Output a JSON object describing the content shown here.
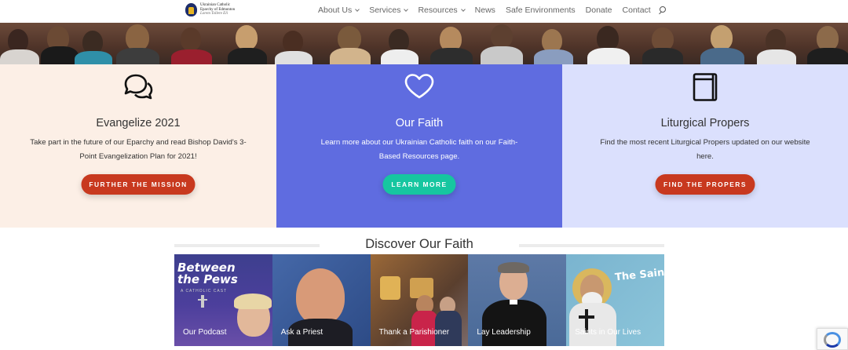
{
  "header": {
    "logo": {
      "line1": "Ukrainian Catholic",
      "line2": "Eparchy of Edmonton",
      "line3": "Lorem Tollere Eli"
    },
    "nav": [
      {
        "label": "About Us",
        "dropdown": true
      },
      {
        "label": "Services",
        "dropdown": true
      },
      {
        "label": "Resources",
        "dropdown": true
      },
      {
        "label": "News",
        "dropdown": false
      },
      {
        "label": "Safe Environments",
        "dropdown": false
      },
      {
        "label": "Donate",
        "dropdown": false
      },
      {
        "label": "Contact",
        "dropdown": false
      }
    ],
    "search_icon": "search-icon"
  },
  "features": [
    {
      "icon": "chat-bubbles-icon",
      "title": "Evangelize 2021",
      "text": "Take part in the future of our Eparchy and read Bishop David's 3-Point Evangelization Plan for 2021!",
      "button": "FURTHER THE MISSION",
      "background": "#fcefe6",
      "button_color": "#c8391f"
    },
    {
      "icon": "heart-icon",
      "title": "Our Faith",
      "text": "Learn more about our Ukrainian Catholic faith on our Faith-Based Resources page.",
      "button": "LEARN MORE",
      "background": "#5f6ce0",
      "button_color": "#16c6a0"
    },
    {
      "icon": "book-icon",
      "title": "Liturgical Propers",
      "text": "Find the most recent Liturgical Propers updated on our website here.",
      "button": "FIND THE PROPERS",
      "background": "#dbe0fd",
      "button_color": "#c8391f"
    }
  ],
  "discover": {
    "title": "Discover Our Faith",
    "tiles": [
      {
        "label": "Our Podcast",
        "art_title": "Between the Pews",
        "art_sub": "A CATHOLIC CAST"
      },
      {
        "label": "Ask a Priest"
      },
      {
        "label": "Thank a Parishioner"
      },
      {
        "label": "Lay Leadership"
      },
      {
        "label": "Saints in Our Lives",
        "art_title": "The Saints i"
      }
    ]
  }
}
